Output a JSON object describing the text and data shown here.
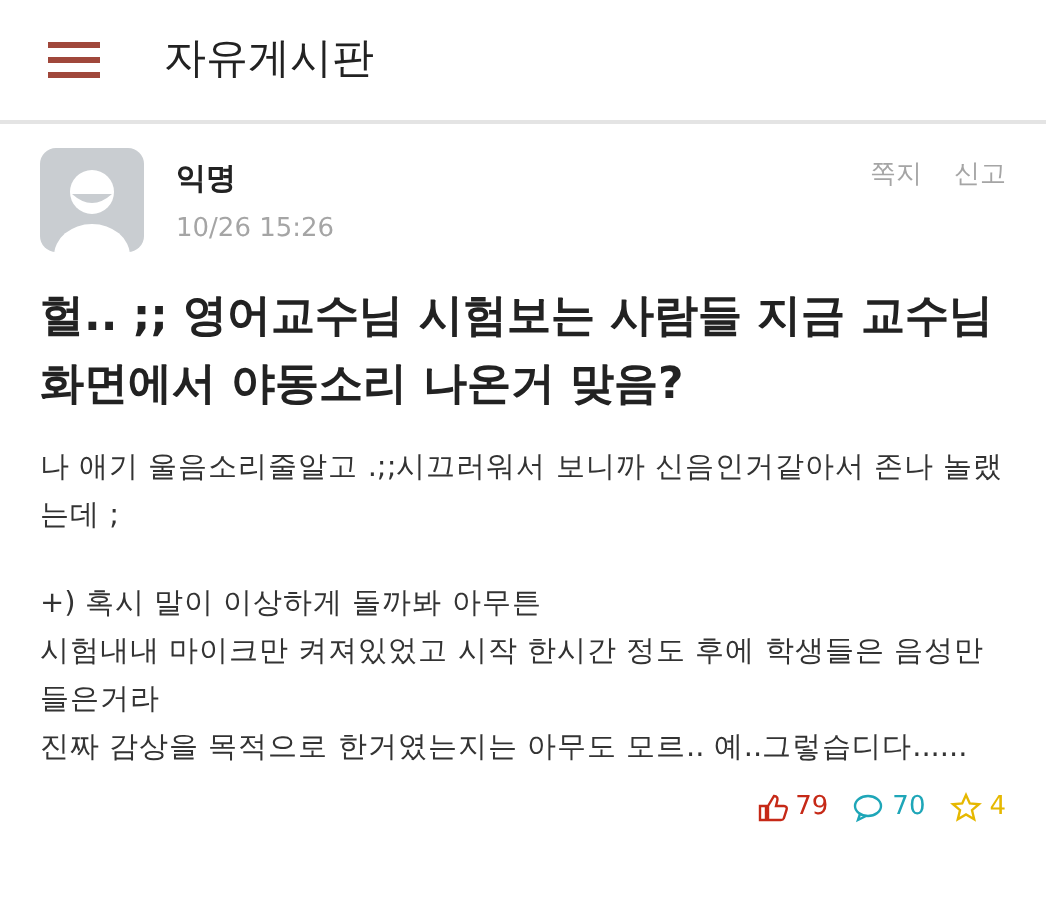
{
  "header": {
    "title": "자유게시판"
  },
  "post": {
    "author": "익명",
    "date": "10/26 15:26",
    "actions": [
      "쪽지",
      "신고"
    ],
    "title": "헐.. ;; 영어교수님 시험보는 사람들 지금 교수님 화면에서 야동소리 나온거 맞음?",
    "paragraphs": [
      "나 애기 울음소리줄알고 .;;시끄러워서 보니까 신음인거같아서 존나 놀랬는데 ;",
      "+) 혹시 말이 이상하게 돌까봐 아무튼\n시험내내 마이크만 켜져있었고 시작 한시간 정도 후에 학생들은 음성만 들은거라\n진짜 감상을 목적으로 한거였는지는 아무도 모르.. 예..그렇습디다......"
    ],
    "stats": [
      {
        "kind": "like",
        "count": "79"
      },
      {
        "kind": "comment",
        "count": "70"
      },
      {
        "kind": "scrap",
        "count": "4"
      }
    ]
  }
}
